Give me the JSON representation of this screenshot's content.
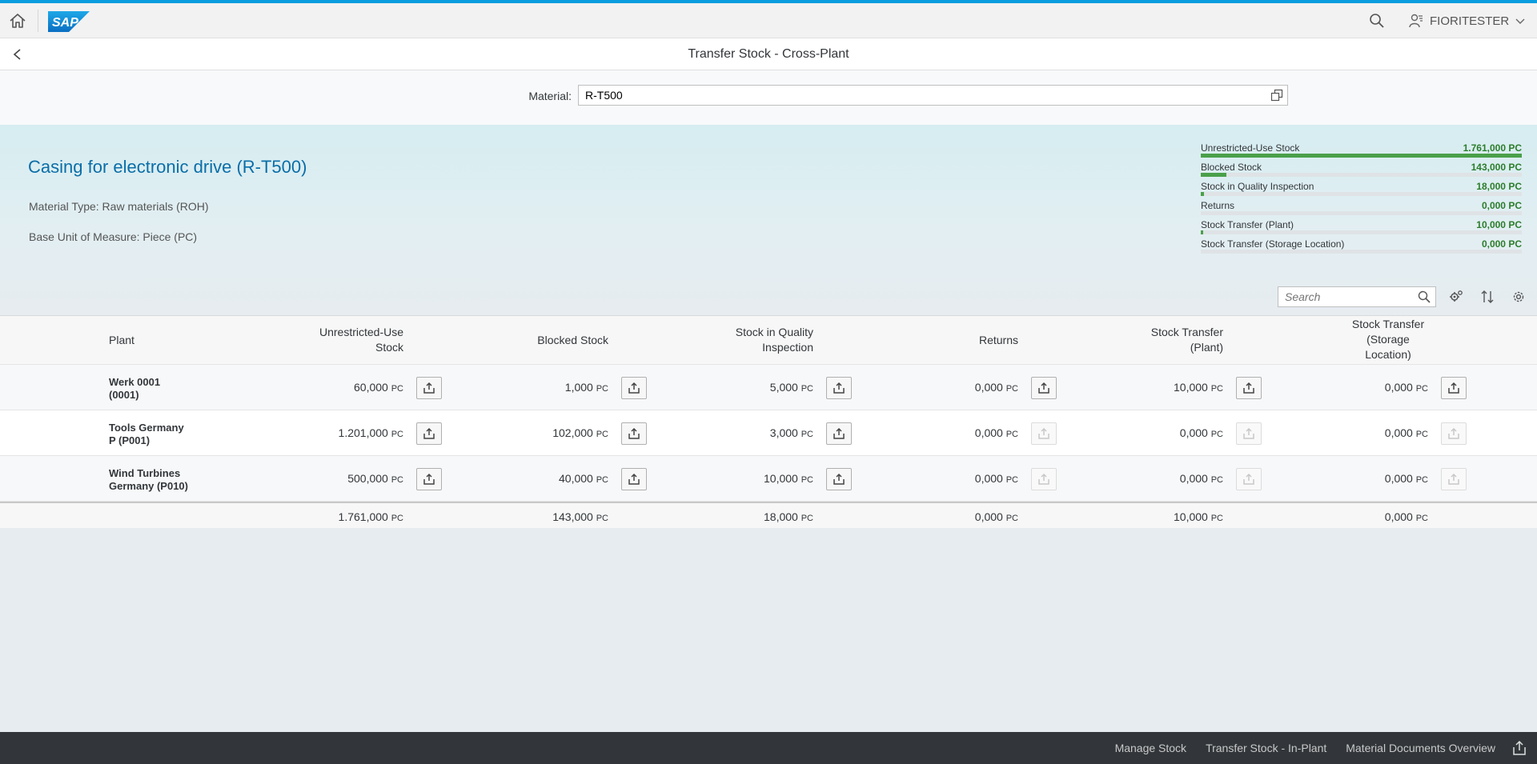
{
  "shell": {
    "logo_text": "SAP",
    "user_name": "FIORITESTER"
  },
  "page": {
    "title": "Transfer Stock - Cross-Plant"
  },
  "material_filter": {
    "label": "Material:",
    "value": "R-T500"
  },
  "object_header": {
    "title": "Casing for electronic drive (R-T500)",
    "material_type": "Material Type: Raw materials (ROH)",
    "base_unit": "Base Unit of Measure: Piece (PC)"
  },
  "kpis": [
    {
      "label": "Unrestricted-Use Stock",
      "value": "1.761,000 PC",
      "fraction": 1.0
    },
    {
      "label": "Blocked Stock",
      "value": "143,000 PC",
      "fraction": 0.081
    },
    {
      "label": "Stock in Quality Inspection",
      "value": "18,000 PC",
      "fraction": 0.0102
    },
    {
      "label": "Returns",
      "value": "0,000 PC",
      "fraction": 0
    },
    {
      "label": "Stock Transfer (Plant)",
      "value": "10,000 PC",
      "fraction": 0.0057
    },
    {
      "label": "Stock Transfer (Storage Location)",
      "value": "0,000 PC",
      "fraction": 0
    }
  ],
  "toolbar": {
    "search_placeholder": "Search"
  },
  "table": {
    "headers": {
      "plant": "Plant",
      "unrestricted_1": "Unrestricted-Use",
      "unrestricted_2": "Stock",
      "blocked": "Blocked Stock",
      "quality_1": "Stock in Quality",
      "quality_2": "Inspection",
      "returns": "Returns",
      "transfer_plant_1": "Stock Transfer",
      "transfer_plant_2": "(Plant)",
      "transfer_sloc_1": "Stock Transfer",
      "transfer_sloc_2": "(Storage",
      "transfer_sloc_3": "Location)"
    },
    "unit": "PC",
    "rows": [
      {
        "plant_1": "Werk 0001",
        "plant_2": "(0001)",
        "values": [
          "60,000",
          "1,000",
          "5,000",
          "0,000",
          "10,000",
          "0,000"
        ],
        "enabled": [
          true,
          true,
          true,
          true,
          true,
          true
        ]
      },
      {
        "plant_1": "Tools Germany",
        "plant_2": "P (P001)",
        "values": [
          "1.201,000",
          "102,000",
          "3,000",
          "0,000",
          "0,000",
          "0,000"
        ],
        "enabled": [
          true,
          true,
          true,
          false,
          false,
          false
        ]
      },
      {
        "plant_1": "Wind Turbines",
        "plant_2": "Germany (P010)",
        "values": [
          "500,000",
          "40,000",
          "10,000",
          "0,000",
          "0,000",
          "0,000"
        ],
        "enabled": [
          true,
          true,
          true,
          false,
          false,
          false
        ]
      }
    ],
    "totals": [
      "1.761,000",
      "143,000",
      "18,000",
      "0,000",
      "10,000",
      "0,000"
    ]
  },
  "footer": {
    "links": [
      "Manage Stock",
      "Transfer Stock - In-Plant",
      "Material Documents Overview"
    ]
  },
  "colors": {
    "accent": "#0a9de0",
    "title_blue": "#0a6ea8",
    "kpi_green": "#2b7d2b",
    "footer_bg": "#32363a"
  }
}
